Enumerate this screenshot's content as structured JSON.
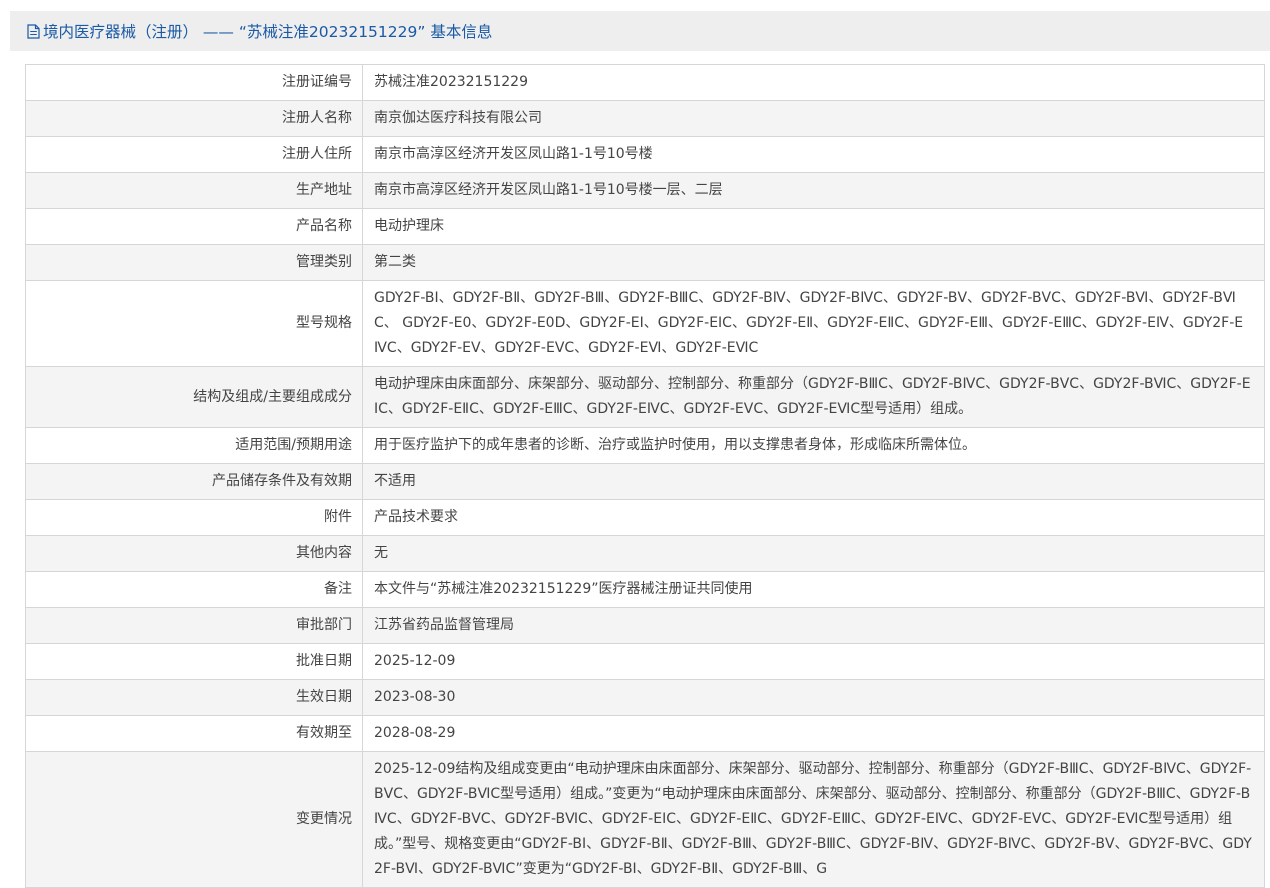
{
  "header": {
    "title": "境内医疗器械（注册） —— “苏械注准20232151229” 基本信息",
    "icon": "document-icon",
    "title_color": "#1a5aa6"
  },
  "rows": [
    {
      "label": "注册证编号",
      "value": "苏械注准20232151229"
    },
    {
      "label": "注册人名称",
      "value": "南京伽达医疗科技有限公司"
    },
    {
      "label": "注册人住所",
      "value": "南京市高淳区经济开发区凤山路1-1号10号楼"
    },
    {
      "label": "生产地址",
      "value": "南京市高淳区经济开发区凤山路1-1号10号楼一层、二层"
    },
    {
      "label": "产品名称",
      "value": "电动护理床"
    },
    {
      "label": "管理类别",
      "value": "第二类"
    },
    {
      "label": "型号规格",
      "value": "GDY2F-BⅠ、GDY2F-BⅡ、GDY2F-BⅢ、GDY2F-BⅢC、GDY2F-BⅣ、GDY2F-BⅣC、GDY2F-BⅤ、GDY2F-BⅤC、GDY2F-BⅥ、GDY2F-BⅥC、 GDY2F-E0、GDY2F-E0D、GDY2F-EⅠ、GDY2F-EⅠC、GDY2F-EⅡ、GDY2F-EⅡC、GDY2F-EⅢ、GDY2F-EⅢC、GDY2F-EⅣ、GDY2F-EⅣC、GDY2F-EⅤ、GDY2F-EⅤC、GDY2F-EⅥ、GDY2F-EⅥC"
    },
    {
      "label": "结构及组成/主要组成成分",
      "value": "电动护理床由床面部分、床架部分、驱动部分、控制部分、称重部分（GDY2F-BⅢC、GDY2F-BⅣC、GDY2F-BⅤC、GDY2F-BⅥC、GDY2F-EⅠC、GDY2F-EⅡC、GDY2F-EⅢC、GDY2F-EⅣC、GDY2F-EⅤC、GDY2F-EⅥC型号适用）组成。"
    },
    {
      "label": "适用范围/预期用途",
      "value": "用于医疗监护下的成年患者的诊断、治疗或监护时使用，用以支撑患者身体，形成临床所需体位。"
    },
    {
      "label": "产品储存条件及有效期",
      "value": "不适用"
    },
    {
      "label": "附件",
      "value": "产品技术要求"
    },
    {
      "label": "其他内容",
      "value": "无"
    },
    {
      "label": "备注",
      "value": "本文件与“苏械注准20232151229”医疗器械注册证共同使用"
    },
    {
      "label": "审批部门",
      "value": "江苏省药品监督管理局"
    },
    {
      "label": "批准日期",
      "value": "2025-12-09"
    },
    {
      "label": "生效日期",
      "value": "2023-08-30"
    },
    {
      "label": "有效期至",
      "value": "2028-08-29"
    },
    {
      "label": "变更情况",
      "value": "2025-12-09结构及组成变更由“电动护理床由床面部分、床架部分、驱动部分、控制部分、称重部分（GDY2F-BⅢC、GDY2F-BⅣC、GDY2F-BⅤC、GDY2F-BⅥC型号适用）组成。”变更为“电动护理床由床面部分、床架部分、驱动部分、控制部分、称重部分（GDY2F-BⅢC、GDY2F-BⅣC、GDY2F-BⅤC、GDY2F-BⅥC、GDY2F-EⅠC、GDY2F-EⅡC、GDY2F-EⅢC、GDY2F-EⅣC、GDY2F-EⅤC、GDY2F-EⅥC型号适用）组成。”型号、规格变更由“GDY2F-BⅠ、GDY2F-BⅡ、GDY2F-BⅢ、GDY2F-BⅢC、GDY2F-BⅣ、GDY2F-BⅣC、GDY2F-BⅤ、GDY2F-BⅤC、GDY2F-BⅥ、GDY2F-BⅥC”变更为“GDY2F-BⅠ、GDY2F-BⅡ、GDY2F-BⅢ、G"
    }
  ]
}
